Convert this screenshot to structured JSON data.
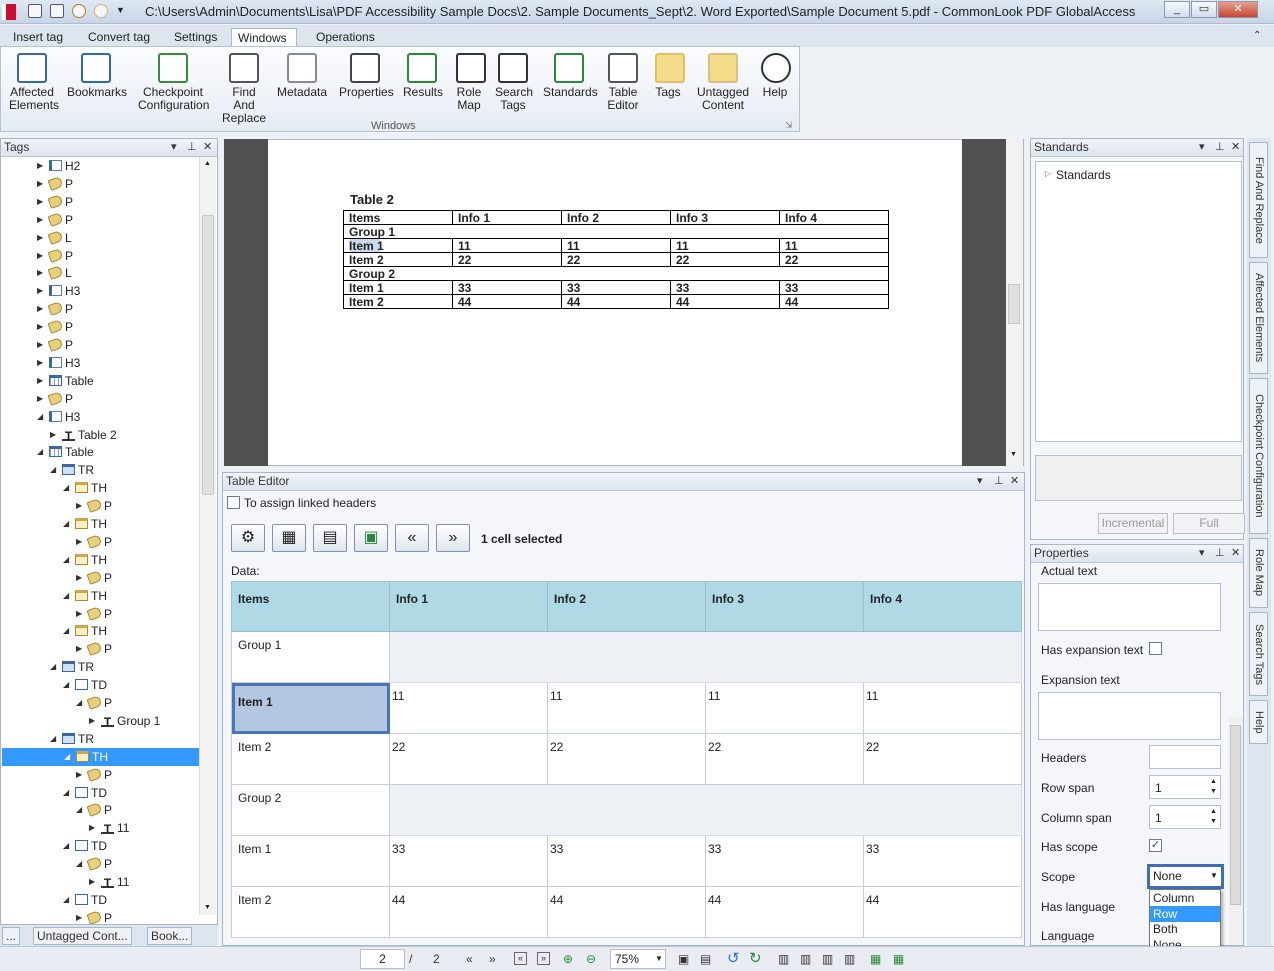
{
  "window": {
    "title": "C:\\Users\\Admin\\Documents\\Lisa\\PDF Accessibility Sample Docs\\2. Sample Documents_Sept\\2. Word Exported\\Sample Document 5.pdf - CommonLook PDF GlobalAccess"
  },
  "menu_tabs": [
    "Insert tag",
    "Convert tag",
    "Settings",
    "Windows",
    "Operations"
  ],
  "active_tab": "Windows",
  "ribbon": {
    "group_label": "Windows",
    "buttons": [
      {
        "line1": "Affected",
        "line2": "Elements",
        "icon": "affected-elements-icon"
      },
      {
        "line1": "Bookmarks",
        "line2": "",
        "icon": "bookmarks-icon"
      },
      {
        "line1": "Checkpoint",
        "line2": "Configuration",
        "icon": "checkpoint-configuration-icon"
      },
      {
        "line1": "Find And",
        "line2": "Replace",
        "icon": "find-replace-icon"
      },
      {
        "line1": "Metadata",
        "line2": "",
        "icon": "metadata-icon"
      },
      {
        "line1": "Properties",
        "line2": "",
        "icon": "properties-icon"
      },
      {
        "line1": "Results",
        "line2": "",
        "icon": "results-icon"
      },
      {
        "line1": "Role",
        "line2": "Map",
        "icon": "role-map-icon"
      },
      {
        "line1": "Search",
        "line2": "Tags",
        "icon": "search-tags-icon"
      },
      {
        "line1": "Standards",
        "line2": "",
        "icon": "standards-icon"
      },
      {
        "line1": "Table",
        "line2": "Editor",
        "icon": "table-editor-icon"
      },
      {
        "line1": "Tags",
        "line2": "",
        "icon": "tags-icon"
      },
      {
        "line1": "Untagged",
        "line2": "Content",
        "icon": "untagged-content-icon"
      },
      {
        "line1": "Help",
        "line2": "",
        "icon": "help-icon"
      }
    ]
  },
  "tags_pane": {
    "title": "Tags",
    "tree": [
      {
        "label": "H2",
        "icon": "h",
        "depth": 0,
        "arrow": "right"
      },
      {
        "label": "P",
        "icon": "p",
        "depth": 0,
        "arrow": "right"
      },
      {
        "label": "P",
        "icon": "p",
        "depth": 0,
        "arrow": "right"
      },
      {
        "label": "P",
        "icon": "p",
        "depth": 0,
        "arrow": "right"
      },
      {
        "label": "L",
        "icon": "l",
        "depth": 0,
        "arrow": "right"
      },
      {
        "label": "P",
        "icon": "p",
        "depth": 0,
        "arrow": "right"
      },
      {
        "label": "L",
        "icon": "l",
        "depth": 0,
        "arrow": "right"
      },
      {
        "label": "H3",
        "icon": "h",
        "depth": 0,
        "arrow": "right"
      },
      {
        "label": "P",
        "icon": "p",
        "depth": 0,
        "arrow": "right"
      },
      {
        "label": "P",
        "icon": "p",
        "depth": 0,
        "arrow": "right"
      },
      {
        "label": "P",
        "icon": "p",
        "depth": 0,
        "arrow": "right"
      },
      {
        "label": "H3",
        "icon": "h",
        "depth": 0,
        "arrow": "right"
      },
      {
        "label": "Table",
        "icon": "tbl",
        "depth": 0,
        "arrow": "right"
      },
      {
        "label": "P",
        "icon": "p",
        "depth": 0,
        "arrow": "right"
      },
      {
        "label": "H3",
        "icon": "h",
        "depth": 0,
        "arrow": "down"
      },
      {
        "label": "Table 2",
        "icon": "t",
        "depth": 1,
        "arrow": "right"
      },
      {
        "label": "Table",
        "icon": "tbl",
        "depth": 0,
        "arrow": "down"
      },
      {
        "label": "TR",
        "icon": "tr",
        "depth": 1,
        "arrow": "down"
      },
      {
        "label": "TH",
        "icon": "th",
        "depth": 2,
        "arrow": "down"
      },
      {
        "label": "P",
        "icon": "p",
        "depth": 3,
        "arrow": "right"
      },
      {
        "label": "TH",
        "icon": "th",
        "depth": 2,
        "arrow": "down"
      },
      {
        "label": "P",
        "icon": "p",
        "depth": 3,
        "arrow": "right"
      },
      {
        "label": "TH",
        "icon": "th",
        "depth": 2,
        "arrow": "down"
      },
      {
        "label": "P",
        "icon": "p",
        "depth": 3,
        "arrow": "right"
      },
      {
        "label": "TH",
        "icon": "th",
        "depth": 2,
        "arrow": "down"
      },
      {
        "label": "P",
        "icon": "p",
        "depth": 3,
        "arrow": "right"
      },
      {
        "label": "TH",
        "icon": "th",
        "depth": 2,
        "arrow": "down"
      },
      {
        "label": "P",
        "icon": "p",
        "depth": 3,
        "arrow": "right"
      },
      {
        "label": "TR",
        "icon": "tr",
        "depth": 1,
        "arrow": "down"
      },
      {
        "label": "TD",
        "icon": "td",
        "depth": 2,
        "arrow": "down"
      },
      {
        "label": "P",
        "icon": "p",
        "depth": 3,
        "arrow": "down"
      },
      {
        "label": "Group 1",
        "icon": "t",
        "depth": 4,
        "arrow": "right"
      },
      {
        "label": "TR",
        "icon": "tr",
        "depth": 1,
        "arrow": "down"
      },
      {
        "label": "TH",
        "icon": "th",
        "depth": 2,
        "arrow": "down",
        "selected": true
      },
      {
        "label": "P",
        "icon": "p",
        "depth": 3,
        "arrow": "right"
      },
      {
        "label": "TD",
        "icon": "td",
        "depth": 2,
        "arrow": "down"
      },
      {
        "label": "P",
        "icon": "p",
        "depth": 3,
        "arrow": "down"
      },
      {
        "label": "11",
        "icon": "t",
        "depth": 4,
        "arrow": "right"
      },
      {
        "label": "TD",
        "icon": "td",
        "depth": 2,
        "arrow": "down"
      },
      {
        "label": "P",
        "icon": "p",
        "depth": 3,
        "arrow": "down"
      },
      {
        "label": "11",
        "icon": "t",
        "depth": 4,
        "arrow": "right"
      },
      {
        "label": "TD",
        "icon": "td",
        "depth": 2,
        "arrow": "down"
      },
      {
        "label": "P",
        "icon": "p",
        "depth": 3,
        "arrow": "right"
      }
    ],
    "bottom_tabs": [
      "...",
      "Untagged Cont...",
      "Book..."
    ]
  },
  "document": {
    "caption": "Table 2",
    "rows": [
      [
        "Items",
        "Info 1",
        "Info 2",
        "Info 3",
        "Info 4"
      ],
      [
        "Group 1"
      ],
      [
        "Item 1",
        "11",
        "11",
        "11",
        "11"
      ],
      [
        "Item 2",
        "22",
        "22",
        "22",
        "22"
      ],
      [
        "Group 2"
      ],
      [
        "Item 1",
        "33",
        "33",
        "33",
        "33"
      ],
      [
        "Item 2",
        "44",
        "44",
        "44",
        "44"
      ]
    ]
  },
  "table_editor": {
    "title": "Table Editor",
    "assign_linked_headers_label": "To assign linked headers",
    "assign_linked_headers_checked": false,
    "status": "1 cell selected",
    "data_label": "Data:",
    "toolbar_buttons": [
      "cell-properties-icon",
      "column-header-icon",
      "row-header-icon",
      "merge-cells-icon",
      "previous-icon",
      "next-icon"
    ],
    "header": [
      "Items",
      "Info 1",
      "Info 2",
      "Info 3",
      "Info 4"
    ],
    "rows": [
      {
        "cells": [
          "Group 1"
        ],
        "group": true
      },
      {
        "cells": [
          "Item 1",
          "11",
          "11",
          "11",
          "11"
        ],
        "selected_first": true
      },
      {
        "cells": [
          "Item 2",
          "22",
          "22",
          "22",
          "22"
        ]
      },
      {
        "cells": [
          "Group 2"
        ],
        "group": true
      },
      {
        "cells": [
          "Item 1",
          "33",
          "33",
          "33",
          "33"
        ]
      },
      {
        "cells": [
          "Item 2",
          "44",
          "44",
          "44",
          "44"
        ]
      }
    ]
  },
  "standards_pane": {
    "title": "Standards",
    "root": "Standards",
    "incremental_label": "Incremental",
    "full_label": "Full"
  },
  "properties_pane": {
    "title": "Properties",
    "actual_text_label": "Actual text",
    "actual_text_value": "",
    "has_expansion_label": "Has expansion text",
    "has_expansion_checked": false,
    "expansion_text_label": "Expansion text",
    "expansion_text_value": "",
    "headers_label": "Headers",
    "headers_value": "",
    "row_span_label": "Row span",
    "row_span_value": "1",
    "column_span_label": "Column span",
    "column_span_value": "1",
    "has_scope_label": "Has scope",
    "has_scope_checked": true,
    "scope_label": "Scope",
    "scope_value": "None",
    "scope_options": [
      "Column",
      "Row",
      "Both",
      "None"
    ],
    "scope_highlighted": "Row",
    "has_language_label": "Has language",
    "language_label": "Language"
  },
  "side_tabs": [
    "Find And Replace",
    "Affected Elements",
    "Checkpoint Configuration",
    "Role Map",
    "Search Tags",
    "Help"
  ],
  "status_bar": {
    "page_current": "2",
    "page_separator": "/",
    "page_total": "2",
    "zoom": "75%"
  },
  "colors": {
    "header_cell": "#afd9e5",
    "selected_cell": "#b4c7e1",
    "selection_border": "#4a75b7",
    "tree_selection": "#3399ff"
  }
}
